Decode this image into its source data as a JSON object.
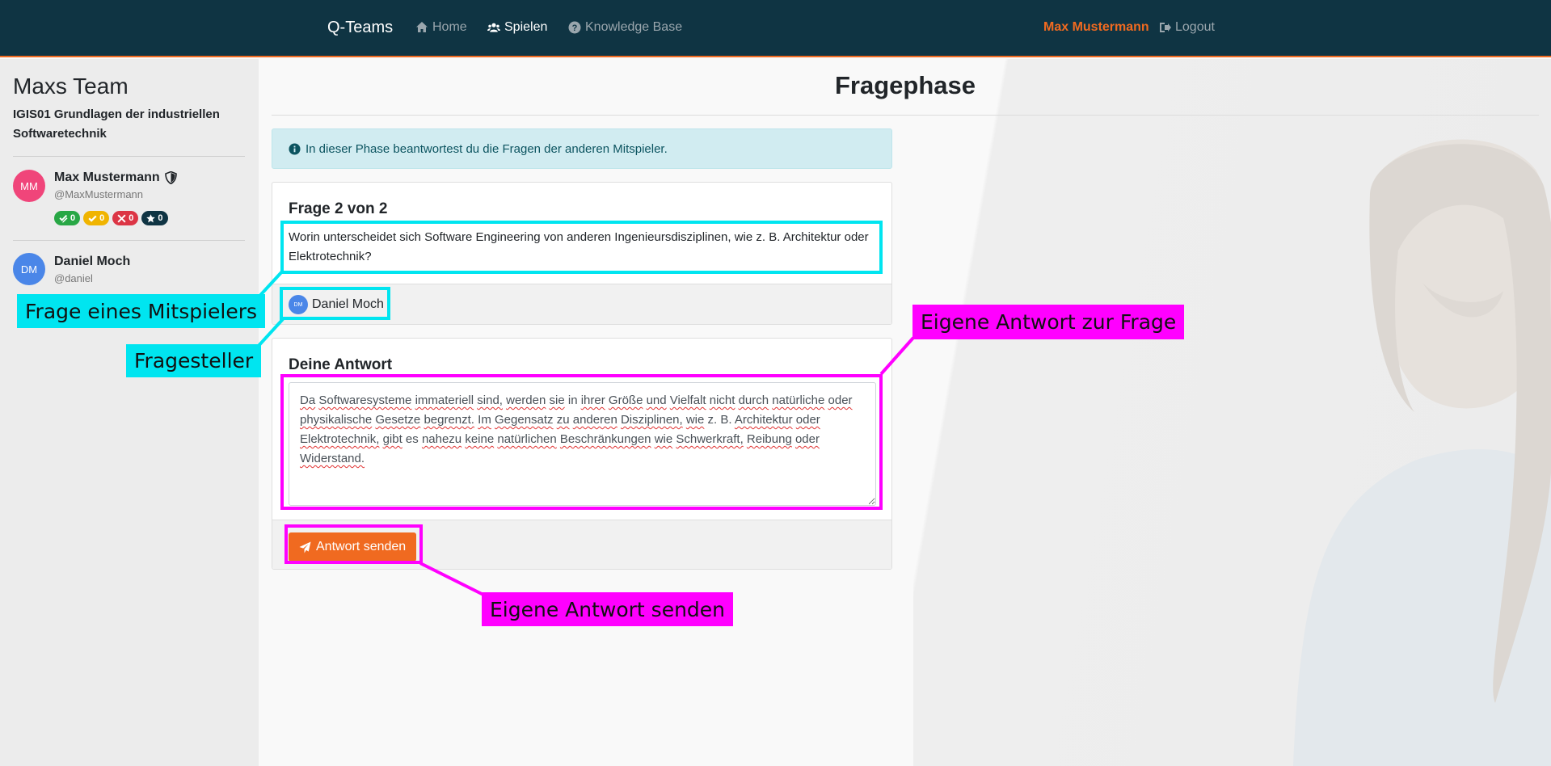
{
  "navbar": {
    "brand": "Q-Teams",
    "home": "Home",
    "play": "Spielen",
    "knowledge_base": "Knowledge Base",
    "user": "Max Mustermann",
    "logout": "Logout"
  },
  "sidebar": {
    "team_name": "Maxs Team",
    "course": "IGIS01 Grundlagen der industriellen Softwaretechnik",
    "members": [
      {
        "initials": "MM",
        "name": "Max Mustermann",
        "handle": "@MaxMustermann",
        "avatar_color": "#f0457a",
        "badges": [
          {
            "value": "0",
            "color": "#28a745",
            "icon": "double-check-icon"
          },
          {
            "value": "0",
            "color": "#f0b400",
            "icon": "check-icon"
          },
          {
            "value": "0",
            "color": "#dc3545",
            "icon": "cross-icon"
          },
          {
            "value": "0",
            "color": "#0f3443",
            "icon": "star-icon"
          }
        ]
      },
      {
        "initials": "DM",
        "name": "Daniel Moch",
        "handle": "@daniel",
        "avatar_color": "#4a86e8"
      }
    ]
  },
  "main": {
    "title": "Fragephase",
    "info": "In dieser Phase beantwortest du die Fragen der anderen Mitspieler.",
    "question_card": {
      "heading": "Frage 2 von 2",
      "question": "Worin unterscheidet sich Software Engineering von anderen Ingenieursdisziplinen, wie z. B. Architektur oder Elektrotechnik?",
      "asker_initials": "DM",
      "asker_name": "Daniel Moch"
    },
    "answer_card": {
      "heading": "Deine Antwort",
      "answer": "Da Softwaresysteme immateriell sind, werden sie in ihrer Größe und Vielfalt nicht durch natürliche oder physikalische Gesetze begrenzt. Im Gegensatz zu anderen Disziplinen, wie z. B. Architektur oder Elektrotechnik, gibt es nahezu keine natürlichen Beschränkungen wie Schwerkraft, Reibung oder Widerstand.",
      "send_label": "Antwort senden"
    }
  },
  "annotations": {
    "question_label": "Frage eines Mitspielers",
    "asker_label": "Fragesteller",
    "answer_label": "Eigene Antwort zur Frage",
    "send_label": "Eigene Antwort senden",
    "color_cyan": "#00e5f0",
    "color_magenta": "#ff00ff"
  },
  "colors": {
    "navbar": "#0f3443",
    "accent": "#f06a20",
    "info_bg": "#d1ecf1",
    "info_text": "#0c5460"
  }
}
